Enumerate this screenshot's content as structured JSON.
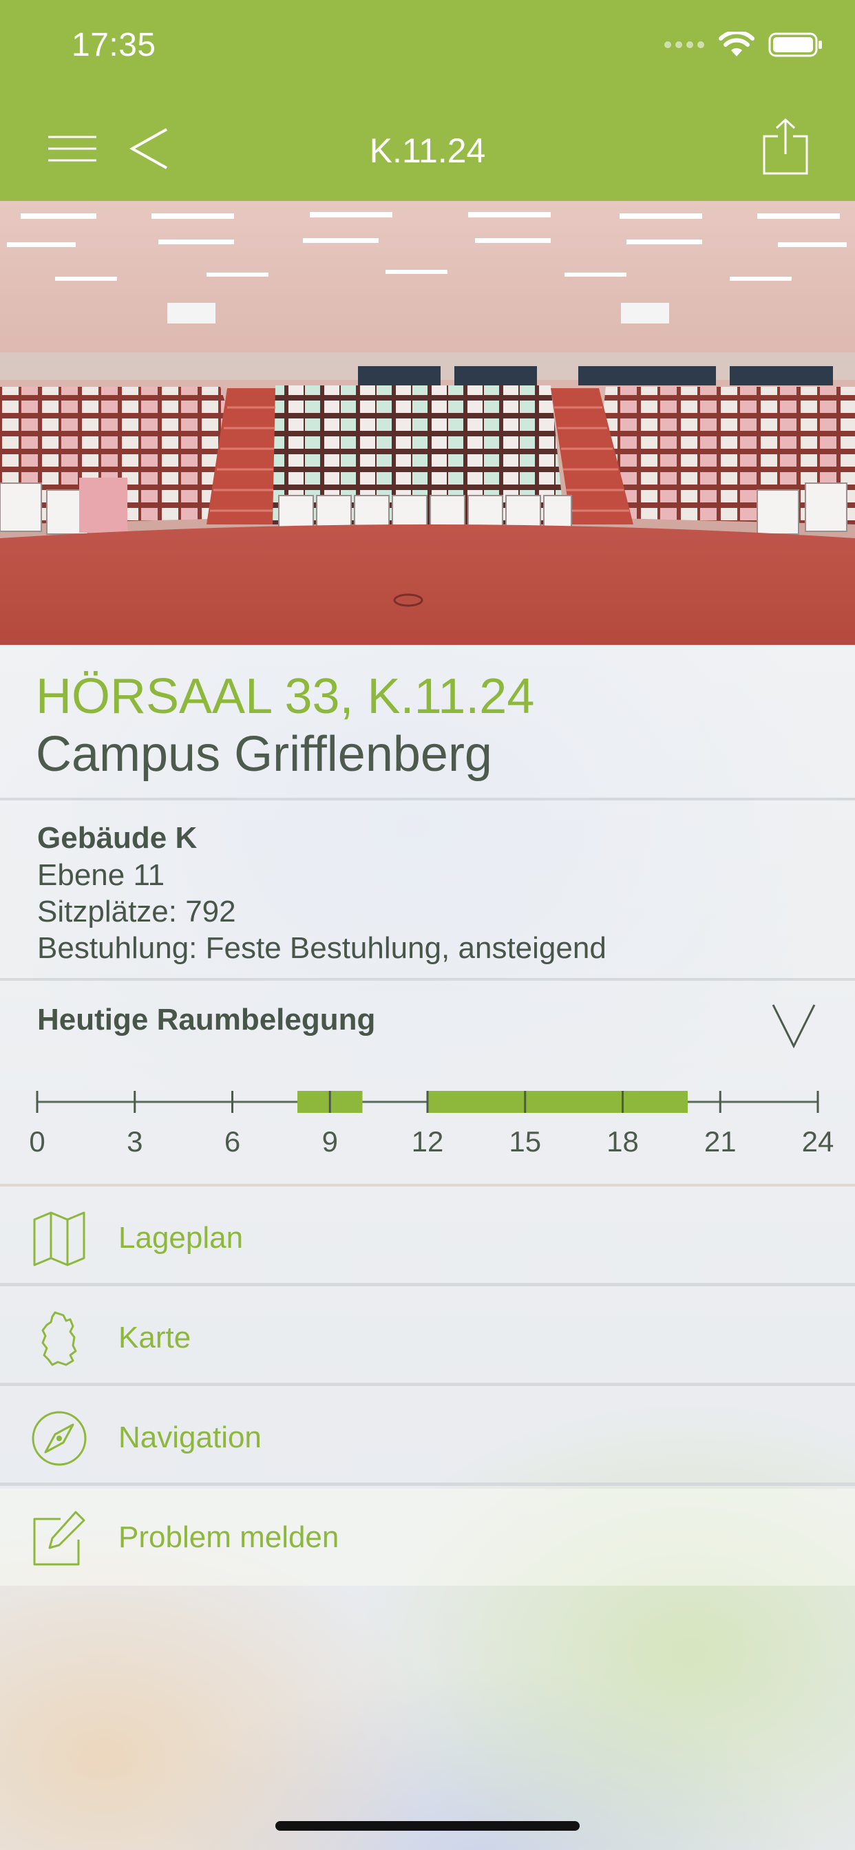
{
  "status_bar": {
    "time": "17:35"
  },
  "nav": {
    "title": "K.11.24",
    "menu_icon": "hamburger-icon",
    "back_icon": "chevron-left-icon",
    "share_icon": "share-icon",
    "bar_color": "#98bb48"
  },
  "hero": {
    "image": "lecture-hall-photo"
  },
  "room": {
    "title": "HÖRSAAL 33, K.11.24",
    "campus": "Campus Grifflenberg"
  },
  "details": {
    "building": "Gebäude K",
    "level": "Ebene 11",
    "seats": "Sitzplätze: 792",
    "seating": "Bestuhlung: Feste Bestuhlung, ansteigend"
  },
  "occupancy": {
    "title": "Heutige Raumbelegung",
    "tick_labels": [
      "0",
      "3",
      "6",
      "9",
      "12",
      "15",
      "18",
      "21",
      "24"
    ],
    "occupied_ranges_hours": [
      [
        8,
        10
      ],
      [
        12,
        20
      ]
    ],
    "accent_color": "#8db83b"
  },
  "actions": [
    {
      "label": "Lageplan",
      "icon": "map-icon"
    },
    {
      "label": "Karte",
      "icon": "germany-map-icon"
    },
    {
      "label": "Navigation",
      "icon": "compass-icon"
    },
    {
      "label": "Problem melden",
      "icon": "edit-report-icon"
    }
  ]
}
